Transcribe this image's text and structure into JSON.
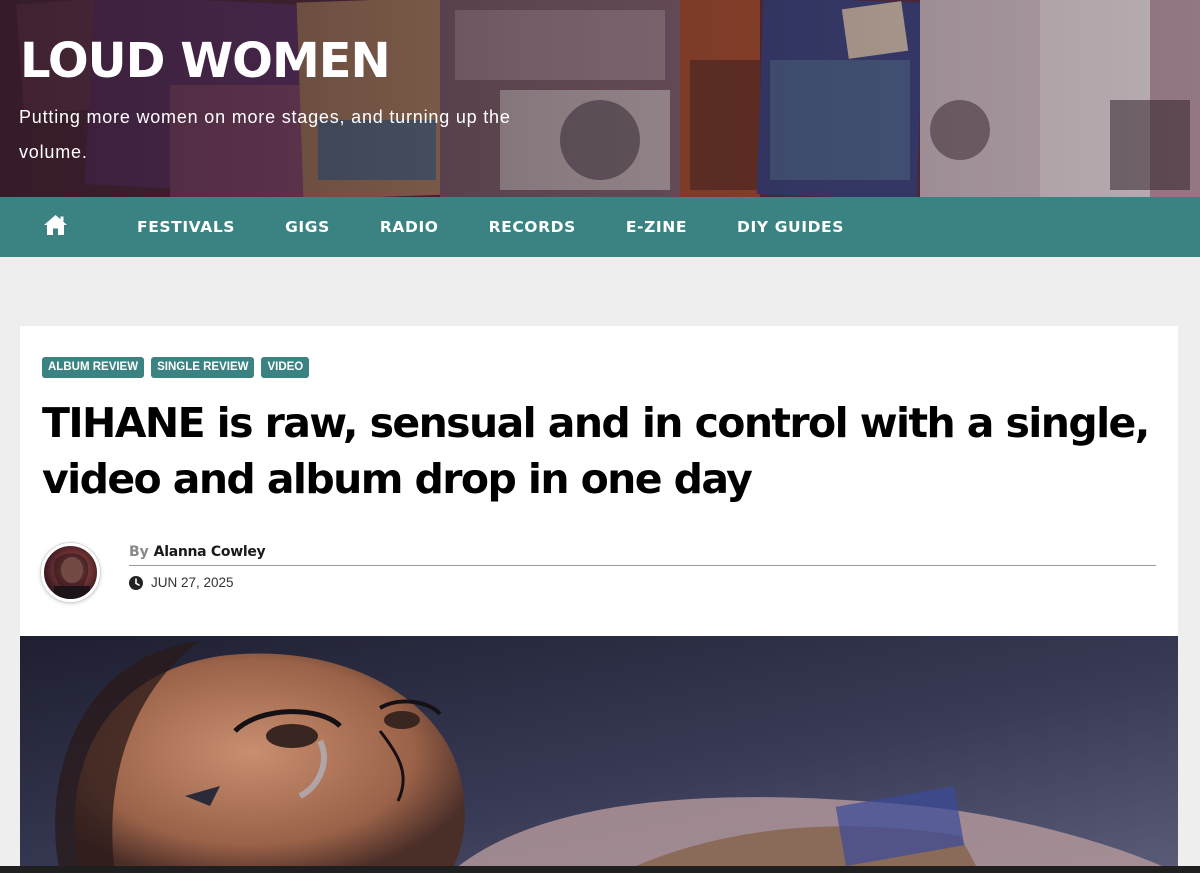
{
  "site": {
    "title": "LOUD WOMEN",
    "tagline": "Putting more women on more stages, and turning up the volume."
  },
  "nav": {
    "home_icon": "home-icon",
    "items": [
      "FESTIVALS",
      "GIGS",
      "RADIO",
      "RECORDS",
      "E-ZINE",
      "DIY GUIDES"
    ]
  },
  "article": {
    "tags": [
      "ALBUM REVIEW",
      "SINGLE REVIEW",
      "VIDEO"
    ],
    "headline": "TIHANE is raw, sensual and in control with a single, video and album drop in one day",
    "by_label": "By",
    "author": "Alanna Cowley",
    "date": "JUN 27, 2025",
    "date_icon": "clock-icon"
  },
  "colors": {
    "accent": "#3a8382",
    "page_bg": "#eeeeee",
    "card_bg": "#ffffff"
  }
}
